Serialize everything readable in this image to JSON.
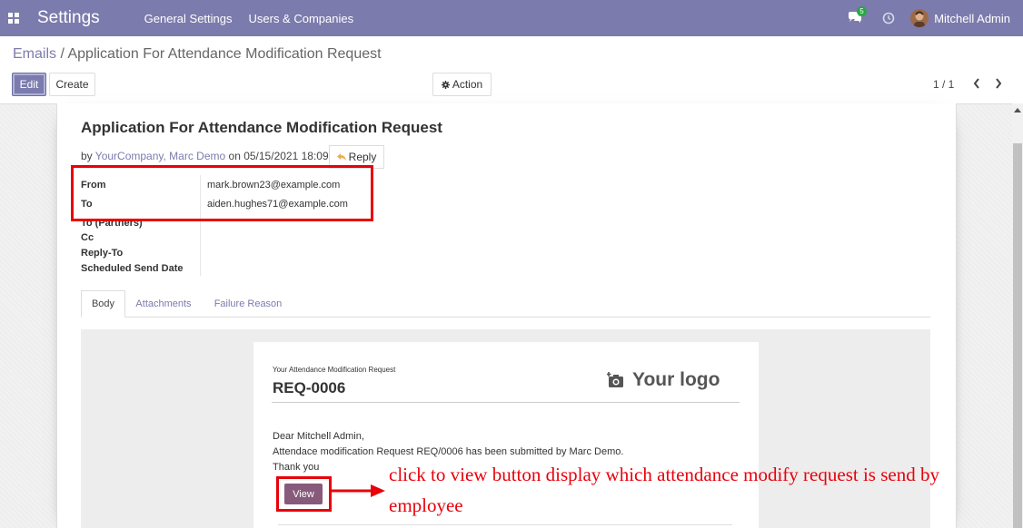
{
  "navbar": {
    "brand": "Settings",
    "menus": [
      "General Settings",
      "Users & Companies"
    ],
    "chat_count": "5",
    "user_name": "Mitchell Admin"
  },
  "breadcrumb": {
    "parent": "Emails",
    "separator": " / ",
    "current": "Application For Attendance Modification Request"
  },
  "toolbar": {
    "edit_label": "Edit",
    "create_label": "Create",
    "action_label": "Action"
  },
  "pager": {
    "value": "1 / 1"
  },
  "mail": {
    "title": "Application For Attendance Modification Request",
    "meta_prefix": "by ",
    "author": "YourCompany, Marc Demo",
    "meta_on": " on ",
    "date": "05/15/2021 18:09:10",
    "reply_label": "Reply",
    "fields": [
      {
        "label": "From",
        "value": "mark.brown23@example.com"
      },
      {
        "label": "To",
        "value": "aiden.hughes71@example.com"
      },
      {
        "label": "To (Partners)",
        "value": ""
      },
      {
        "label": "Cc",
        "value": ""
      },
      {
        "label": "Reply-To",
        "value": ""
      },
      {
        "label": "Scheduled Send Date",
        "value": ""
      }
    ]
  },
  "tabs": [
    "Body",
    "Attachments",
    "Failure Reason"
  ],
  "email": {
    "kicker": "Your Attendance Modification Request",
    "reference": "REQ-0006",
    "logo_text": "Your logo",
    "greeting": "Dear Mitchell Admin,",
    "message": "Attendace modification Request REQ/0006 has been submitted by Marc Demo.",
    "closing": "Thank you",
    "view_label": "View"
  },
  "annotation": {
    "note": "click to view button display which attendance modify request is send by employee"
  },
  "colors": {
    "navbar": "#7c7bad",
    "view_button": "#875a7b",
    "annotation": "#e8000b"
  }
}
